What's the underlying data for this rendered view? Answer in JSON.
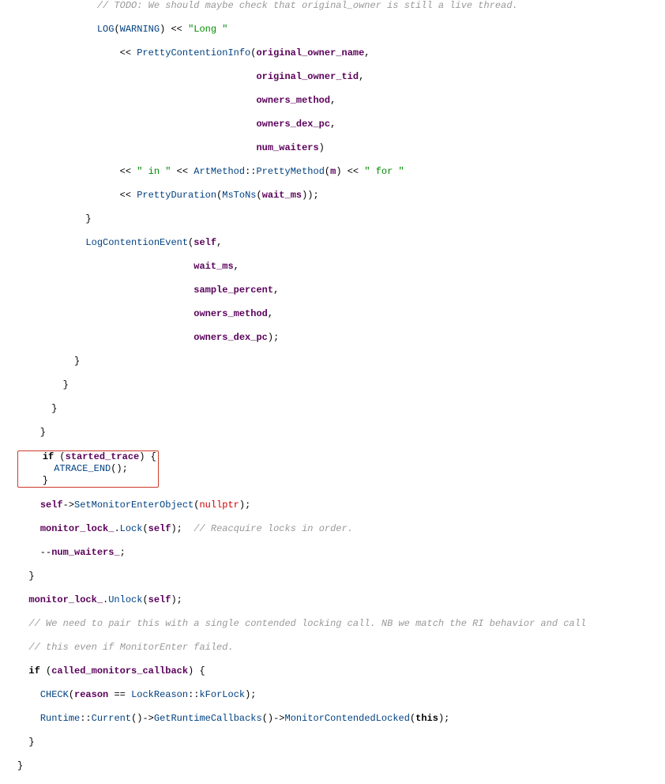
{
  "code": {
    "l01": "// TODO: We should maybe check that original_owner is still a live thread.",
    "log": "LOG",
    "warning": "WARNING",
    "long": "\"Long \"",
    "pci": "PrettyContentionInfo",
    "arg_oon": "original_owner_name",
    "arg_oot": "original_owner_tid",
    "arg_om": "owners_method",
    "arg_odp": "owners_dex_pc",
    "arg_nw": "num_waiters",
    "in": "\" in \"",
    "for": "\" for \"",
    "artmethod": "ArtMethod",
    "pretty": "PrettyMethod",
    "m": "m",
    "pd": "PrettyDuration",
    "mstons": "MsToNs",
    "waitms": "wait_ms",
    "lce": "LogContentionEvent",
    "self": "self",
    "sample": "sample_percent",
    "if": "if",
    "started_trace": "started_trace",
    "atrace_end": "ATRACE_END",
    "setmon": "SetMonitorEnterObject",
    "nullptr": "nullptr",
    "monlock": "monitor_lock_",
    "lock": "Lock",
    "unlock": "Unlock",
    "reacq": "// Reacquire locks in order.",
    "numwait": "num_waiters_",
    "cmt_pair1": "// We need to pair this with a single contended locking call. NB we match the RI behavior and call",
    "cmt_pair2": "// this even if MonitorEnter failed.",
    "called_mcb": "called_monitors_callback",
    "check": "CHECK",
    "reason": "reason",
    "lockreason": "LockReason",
    "kforlock": "kForLock",
    "runtime": "Runtime",
    "current": "Current",
    "getrc": "GetRuntimeCallbacks",
    "mcl": "MonitorContendedLocked",
    "this": "this"
  }
}
